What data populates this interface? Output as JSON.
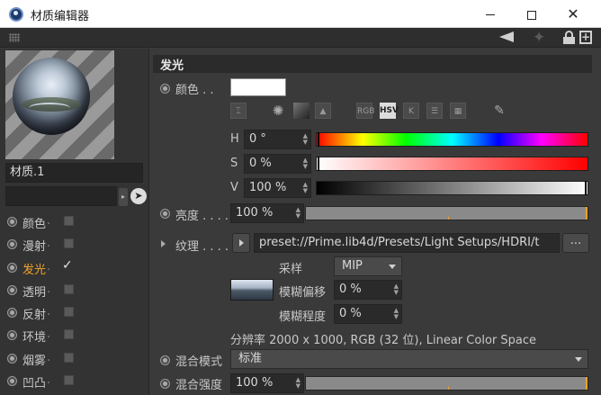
{
  "window": {
    "title": "材质编辑器"
  },
  "preview": {
    "material_name": "材质.1"
  },
  "channels": [
    {
      "label": "颜色",
      "dots": ".",
      "checked": false,
      "active": false
    },
    {
      "label": "漫射",
      "dots": ".",
      "checked": false,
      "active": false
    },
    {
      "label": "发光",
      "dots": ".",
      "checked": true,
      "active": true
    },
    {
      "label": "透明",
      "dots": ".",
      "checked": false,
      "active": false
    },
    {
      "label": "反射",
      "dots": ".",
      "checked": false,
      "active": false
    },
    {
      "label": "环境",
      "dots": ".",
      "checked": false,
      "active": false
    },
    {
      "label": "烟雾",
      "dots": ".",
      "checked": false,
      "active": false
    },
    {
      "label": "凹凸",
      "dots": ".",
      "checked": false,
      "active": false
    }
  ],
  "section": {
    "title": "发光"
  },
  "color": {
    "label": "颜色 . .",
    "swatch": "#ffffff",
    "tools": [
      "RGB",
      "HSV",
      "K"
    ],
    "h_label": "H",
    "h_value": "0 °",
    "s_label": "S",
    "s_value": "0 %",
    "v_label": "V",
    "v_value": "100 %"
  },
  "brightness": {
    "label": "亮度 . . . .",
    "value": "100 %",
    "fraction": 1.0
  },
  "texture": {
    "label": "纹理 . . . .",
    "path": "preset://Prime.lib4d/Presets/Light Setups/HDRI/t",
    "more": "...",
    "sampling_label": "采样",
    "sampling_value": "MIP",
    "blur_offset_label": "模糊偏移",
    "blur_offset_value": "0 %",
    "blur_scale_label": "模糊程度",
    "blur_scale_value": "0 %",
    "resolution": "分辨率 2000 x 1000, RGB (32 位), Linear Color Space"
  },
  "mix_mode": {
    "label": "混合模式",
    "value": "标准"
  },
  "mix_strength": {
    "label": "混合强度",
    "value": "100 %",
    "fraction": 1.0
  }
}
